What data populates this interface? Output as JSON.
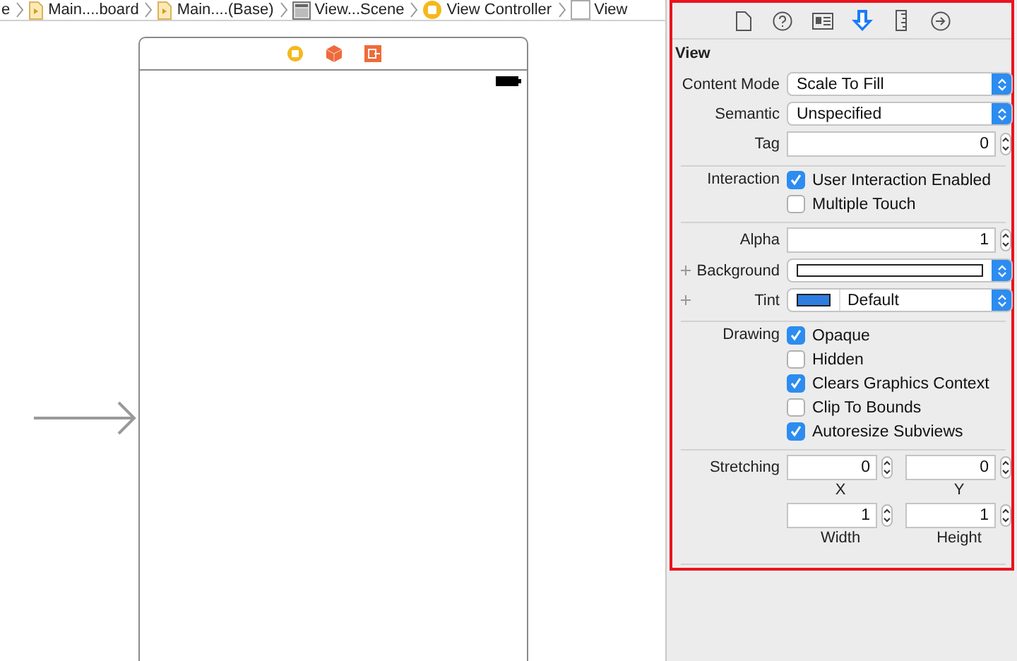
{
  "breadcrumbs": [
    {
      "kind": "plain",
      "label": "e"
    },
    {
      "kind": "storyboard",
      "label": "Main....board"
    },
    {
      "kind": "storyboard",
      "label": "Main....(Base)"
    },
    {
      "kind": "scene",
      "label": "View...Scene"
    },
    {
      "kind": "controller",
      "label": "View Controller"
    },
    {
      "kind": "view",
      "label": "View"
    }
  ],
  "inspector": {
    "tabs": [
      {
        "kind": "file",
        "selected": false
      },
      {
        "kind": "help",
        "selected": false
      },
      {
        "kind": "identity",
        "selected": false
      },
      {
        "kind": "attributes",
        "selected": true
      },
      {
        "kind": "size",
        "selected": false
      },
      {
        "kind": "connections",
        "selected": false
      }
    ],
    "section_title": "View",
    "groups": [
      [
        {
          "kind": "popup",
          "label": "Content Mode",
          "value": "Scale To Fill"
        },
        {
          "kind": "popup",
          "label": "Semantic",
          "value": "Unspecified"
        },
        {
          "kind": "number",
          "label": "Tag",
          "value": "0"
        }
      ],
      [
        {
          "kind": "checks",
          "label": "Interaction",
          "options": [
            {
              "label": "User Interaction Enabled",
              "checked": true
            },
            {
              "label": "Multiple Touch",
              "checked": false
            }
          ]
        }
      ],
      [
        {
          "kind": "number",
          "label": "Alpha",
          "value": "1"
        },
        {
          "kind": "color",
          "label": "Background",
          "color": "#ffffff",
          "addable": true
        },
        {
          "kind": "color",
          "label": "Tint",
          "color": "#2f7de1",
          "value": "Default",
          "addable": true
        }
      ],
      [
        {
          "kind": "checks",
          "label": "Drawing",
          "options": [
            {
              "label": "Opaque",
              "checked": true
            },
            {
              "label": "Hidden",
              "checked": false
            },
            {
              "label": "Clears Graphics Context",
              "checked": true
            },
            {
              "label": "Clip To Bounds",
              "checked": false
            },
            {
              "label": "Autoresize Subviews",
              "checked": true
            }
          ]
        }
      ]
    ],
    "stretching": {
      "label": "Stretching",
      "fields": [
        {
          "value": "0",
          "caption": "X"
        },
        {
          "value": "0",
          "caption": "Y"
        },
        {
          "value": "1",
          "caption": "Width"
        },
        {
          "value": "1",
          "caption": "Height"
        }
      ]
    }
  }
}
